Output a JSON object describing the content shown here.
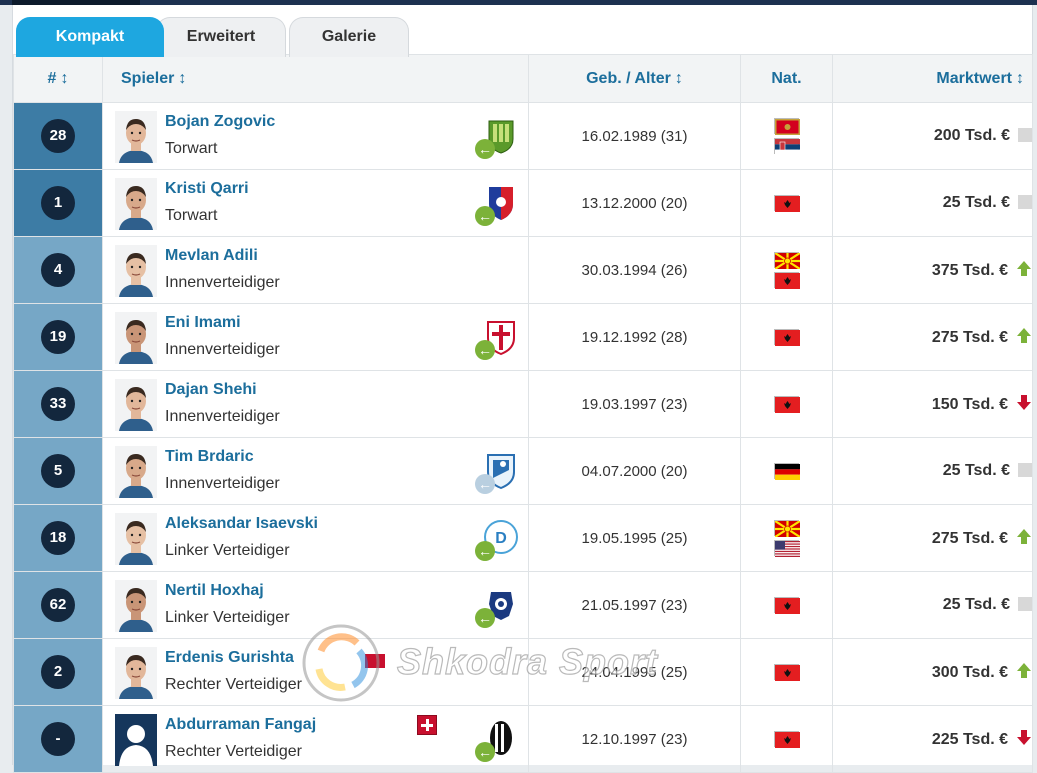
{
  "tabs": [
    "Kompakt",
    "Erweitert",
    "Galerie"
  ],
  "columns": {
    "number": "#",
    "player": "Spieler",
    "dob": "Geb. / Alter",
    "nat": "Nat.",
    "value": "Marktwert",
    "sort_icon": "↕"
  },
  "players": [
    {
      "number": "28",
      "name": "Bojan Zogovic",
      "position": "Torwart",
      "dob": "16.02.1989 (31)",
      "value": "200 Tsd. €",
      "trend": "neutral",
      "flags": [
        "montenegro",
        "serbia"
      ],
      "club": "green-club",
      "arrow": "normal"
    },
    {
      "number": "1",
      "name": "Kristi Qarri",
      "position": "Torwart",
      "dob": "13.12.2000 (20)",
      "value": "25 Tsd. €",
      "trend": "neutral",
      "flags": [
        "albania"
      ],
      "club": "blue-red-club",
      "arrow": "normal"
    },
    {
      "number": "4",
      "name": "Mevlan Adili",
      "position": "Innenverteidiger",
      "dob": "30.03.1994 (26)",
      "value": "375 Tsd. €",
      "trend": "up",
      "flags": [
        "north-macedonia",
        "albania"
      ],
      "club": "",
      "arrow": ""
    },
    {
      "number": "19",
      "name": "Eni Imami",
      "position": "Innenverteidiger",
      "dob": "19.12.1992 (28)",
      "value": "275 Tsd. €",
      "trend": "up",
      "flags": [
        "albania"
      ],
      "club": "red-white-club",
      "arrow": "normal"
    },
    {
      "number": "33",
      "name": "Dajan Shehi",
      "position": "Innenverteidiger",
      "dob": "19.03.1997 (23)",
      "value": "150 Tsd. €",
      "trend": "down",
      "flags": [
        "albania"
      ],
      "club": "",
      "arrow": ""
    },
    {
      "number": "5",
      "name": "Tim Brdaric",
      "position": "Innenverteidiger",
      "dob": "04.07.2000 (20)",
      "value": "25 Tsd. €",
      "trend": "neutral",
      "flags": [
        "germany"
      ],
      "club": "light-blue-club",
      "arrow": "faded"
    },
    {
      "number": "18",
      "name": "Aleksandar Isaevski",
      "position": "Linker Verteidiger",
      "dob": "19.05.1995 (25)",
      "value": "275 Tsd. €",
      "trend": "up",
      "flags": [
        "north-macedonia",
        "usa"
      ],
      "club": "dinamo-club",
      "arrow": "normal"
    },
    {
      "number": "62",
      "name": "Nertil Hoxhaj",
      "position": "Linker Verteidiger",
      "dob": "21.05.1997 (23)",
      "value": "25 Tsd. €",
      "trend": "neutral",
      "flags": [
        "albania"
      ],
      "club": "navy-club",
      "arrow": "normal"
    },
    {
      "number": "2",
      "name": "Erdenis Gurishta",
      "position": "Rechter Verteidiger",
      "dob": "24.04.1995 (25)",
      "value": "300 Tsd. €",
      "trend": "up",
      "flags": [
        "albania"
      ],
      "club": "",
      "arrow": ""
    },
    {
      "number": "-",
      "name": "Abdurraman Fangaj",
      "position": "Rechter Verteidiger",
      "dob": "12.10.1997 (23)",
      "value": "225 Tsd. €",
      "trend": "down",
      "flags": [
        "albania"
      ],
      "club": "black-white-club",
      "arrow": "normal"
    }
  ],
  "watermark": "Shkodra Sport",
  "colors": {
    "accent": "#1ea7e0",
    "link": "#1c6e9c",
    "number_bg_dark": "#3d7ca5",
    "number_bg_light": "#76a7c6",
    "trend_up": "#7cb239",
    "trend_down": "#c8102e"
  }
}
